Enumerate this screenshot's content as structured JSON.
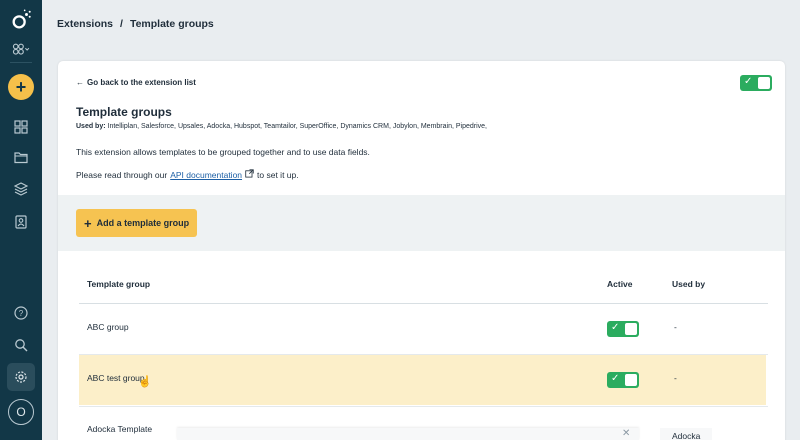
{
  "sidebar": {
    "logo": "logo-icon",
    "items": [
      {
        "name": "modules-icon"
      },
      {
        "name": "add-icon"
      },
      {
        "name": "dashboard-icon"
      },
      {
        "name": "folder-icon"
      },
      {
        "name": "layers-icon"
      },
      {
        "name": "contacts-icon"
      },
      {
        "name": "help-icon"
      },
      {
        "name": "search-icon"
      },
      {
        "name": "settings-icon"
      }
    ],
    "avatar_initial": "O"
  },
  "breadcrumb": {
    "parent": "Extensions",
    "separator": "/",
    "current": "Template groups"
  },
  "card": {
    "back_link": "Go back to the extension list",
    "title": "Template groups",
    "used_by_label": "Used by:",
    "used_by_value": "Intelliplan, Salesforce, Upsales, Adocka, Hubspot, Teamtailor, SuperOffice, Dynamics CRM, Jobylon, Membrain, Pipedrive,",
    "description": "This extension allows templates to be grouped together and to use data fields.",
    "read_prefix": "Please read through our",
    "api_link": "API documentation",
    "read_suffix": "to set it up.",
    "extension_enabled": true
  },
  "actions": {
    "add_button": "Add a template group"
  },
  "table": {
    "headers": {
      "group": "Template group",
      "active": "Active",
      "used_by": "Used by"
    },
    "rows": [
      {
        "group": "ABC group",
        "active": true,
        "used_by": "-"
      },
      {
        "group": "ABC test group",
        "active": true,
        "used_by": "-"
      },
      {
        "group": "Adocka Template",
        "active": true,
        "used_by": "Adocka"
      }
    ]
  },
  "colors": {
    "sidebar_bg": "#123747",
    "accent_yellow": "#f6c351",
    "toggle_green": "#2bac5f",
    "highlight_row": "#fcefc9"
  }
}
